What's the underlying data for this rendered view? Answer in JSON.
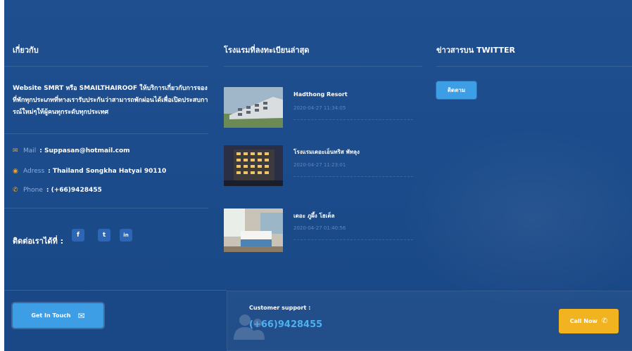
{
  "about": {
    "heading": "เกี่ยวกับ",
    "text": "Website SMRT หรือ SMAILTHAIROOF ให้บริการเกี่ยวกับการจองที่พักทุกประเภทที่ทางเรารับประกันว่าสามารถพักผ่อนได้เพื่อเปิดประสบการณ์ใหม่ๆให้ผู้คนทุกระดับทุกประเทศ",
    "mail_label": "Mail",
    "mail_value": "Suppasan@hotmail.com",
    "address_label": "Adress",
    "address_value": "Thailand Songkha Hatyai 90110",
    "phone_label": "Phone",
    "phone_value": "(+66)9428455",
    "follow_label": "ติดต่อเราได้ที่ :",
    "social": [
      "f",
      "t",
      "in"
    ]
  },
  "hotels": {
    "heading": "โรงแรมที่ลงทะเบียนล่าสุด",
    "items": [
      {
        "name": "Hadthong Resort",
        "date": "2020-04-27 11:34:05"
      },
      {
        "name": "โรงแรมเดอะเอ็นทริส พัทลุง",
        "date": "2020-04-27 11:23:01"
      },
      {
        "name": "เดอะ ภูผึ้ง โฮเต็ล",
        "date": "2020-04-27 01:40:56"
      }
    ]
  },
  "twitter": {
    "heading": "ข่าวสารบน TWITTER",
    "follow_button": "ติดตาม"
  },
  "bottom": {
    "get_in_touch": "Get In Touch",
    "support_label": "Customer support :",
    "support_phone": "(+66)9428455",
    "call_now": "Call Now"
  }
}
